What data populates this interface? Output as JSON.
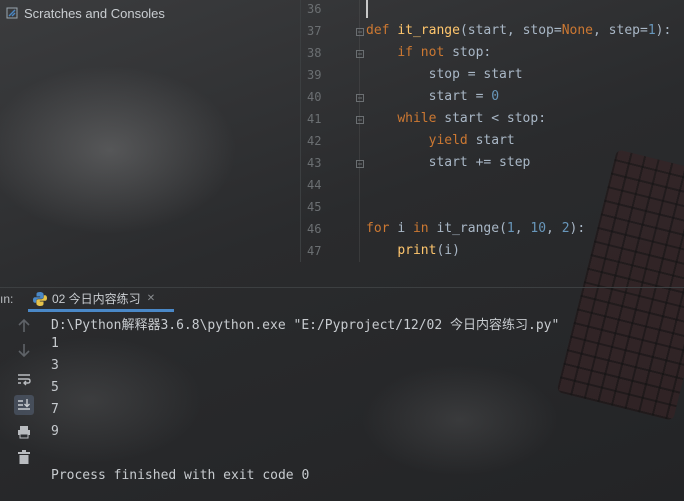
{
  "project_panel": {
    "scratches_label": "Scratches and Consoles"
  },
  "editor": {
    "lines": [
      {
        "n": "36",
        "segs": []
      },
      {
        "n": "37",
        "segs": [
          {
            "t": "def ",
            "c": "kw"
          },
          {
            "t": "it_range",
            "c": "fn"
          },
          {
            "t": "(start, ",
            "c": ""
          },
          {
            "t": "stop",
            "c": ""
          },
          {
            "t": "=",
            "c": ""
          },
          {
            "t": "None",
            "c": "kw"
          },
          {
            "t": ", ",
            "c": ""
          },
          {
            "t": "step",
            "c": ""
          },
          {
            "t": "=",
            "c": ""
          },
          {
            "t": "1",
            "c": "num"
          },
          {
            "t": "):",
            "c": ""
          }
        ]
      },
      {
        "n": "38",
        "segs": [
          {
            "t": "    ",
            "c": ""
          },
          {
            "t": "if not ",
            "c": "kw"
          },
          {
            "t": "stop:",
            "c": ""
          }
        ]
      },
      {
        "n": "39",
        "segs": [
          {
            "t": "        stop = start",
            "c": ""
          }
        ]
      },
      {
        "n": "40",
        "segs": [
          {
            "t": "        start = ",
            "c": ""
          },
          {
            "t": "0",
            "c": "num"
          }
        ]
      },
      {
        "n": "41",
        "segs": [
          {
            "t": "    ",
            "c": ""
          },
          {
            "t": "while ",
            "c": "kw"
          },
          {
            "t": "start < stop:",
            "c": ""
          }
        ]
      },
      {
        "n": "42",
        "segs": [
          {
            "t": "        ",
            "c": ""
          },
          {
            "t": "yield ",
            "c": "kw"
          },
          {
            "t": "start",
            "c": ""
          }
        ]
      },
      {
        "n": "43",
        "segs": [
          {
            "t": "        start += step",
            "c": ""
          }
        ]
      },
      {
        "n": "44",
        "segs": []
      },
      {
        "n": "45",
        "segs": []
      },
      {
        "n": "46",
        "segs": [
          {
            "t": "for ",
            "c": "kw"
          },
          {
            "t": "i ",
            "c": ""
          },
          {
            "t": "in ",
            "c": "kw"
          },
          {
            "t": "it_range(",
            "c": ""
          },
          {
            "t": "1",
            "c": "num"
          },
          {
            "t": ", ",
            "c": ""
          },
          {
            "t": "10",
            "c": "num"
          },
          {
            "t": ", ",
            "c": ""
          },
          {
            "t": "2",
            "c": "num"
          },
          {
            "t": "):",
            "c": ""
          }
        ]
      },
      {
        "n": "47",
        "segs": [
          {
            "t": "    ",
            "c": ""
          },
          {
            "t": "print",
            "c": "fn"
          },
          {
            "t": "(i)",
            "c": ""
          }
        ]
      }
    ]
  },
  "run": {
    "prefix": "ın:",
    "tab_label": "02 今日内容练习",
    "console_lines": [
      "D:\\Python解释器3.6.8\\python.exe \"E:/Pyproject/12/02 今日内容练习.py\"",
      "1",
      "3",
      "5",
      "7",
      "9",
      "",
      "Process finished with exit code 0"
    ]
  },
  "icons": {
    "scratches": "scratches-icon",
    "python": "python-icon",
    "toolbar": [
      "arrow-up-icon",
      "arrow-down-icon",
      "soft-wrap-icon",
      "scroll-to-end-icon",
      "print-icon",
      "trash-icon"
    ]
  },
  "colors": {
    "keyword": "#cc7832",
    "function": "#ffc66d",
    "number": "#6897bb",
    "text": "#a9b7c6",
    "tab_underline": "#4a88c7"
  }
}
